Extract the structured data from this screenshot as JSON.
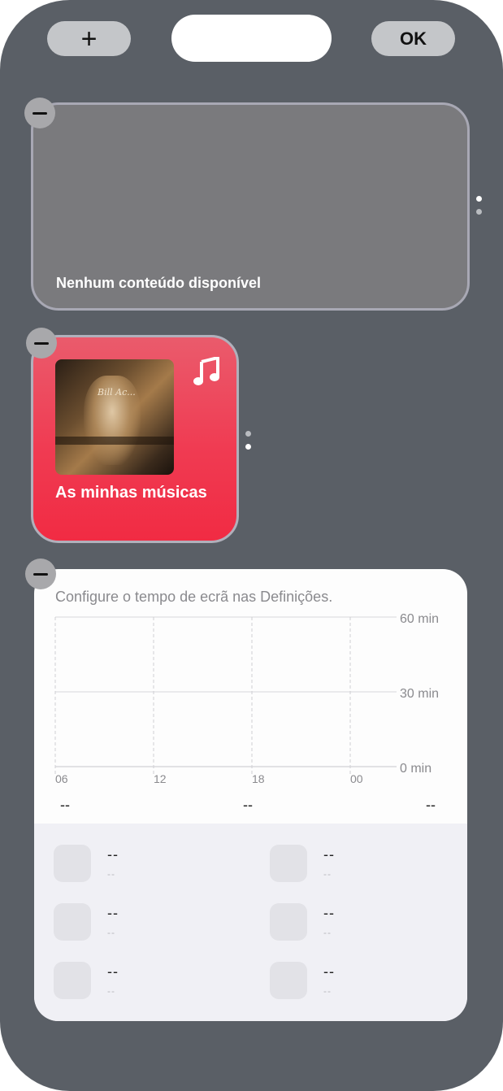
{
  "top_bar": {
    "add_label": "+",
    "done_label": "OK"
  },
  "widgets": {
    "empty_widget": {
      "message": "Nenhum conteúdo disponível"
    },
    "music_widget": {
      "title": "As minhas músicas",
      "icon": "music-note-icon",
      "album_text": "Bill Ac..."
    },
    "screen_time": {
      "message": "Configure o tempo de ecrã nas Definições.",
      "y_labels": [
        "60 min",
        "30 min",
        "0 min"
      ],
      "x_labels": [
        "06",
        "12",
        "18",
        "00"
      ],
      "totals": [
        "--",
        "--",
        "--"
      ],
      "apps": [
        {
          "time": "--",
          "sub": "--"
        },
        {
          "time": "--",
          "sub": "--"
        },
        {
          "time": "--",
          "sub": "--"
        },
        {
          "time": "--",
          "sub": "--"
        },
        {
          "time": "--",
          "sub": "--"
        },
        {
          "time": "--",
          "sub": "--"
        }
      ]
    }
  },
  "colors": {
    "background": "#5a5f66",
    "music_accent": "#f03b52"
  }
}
